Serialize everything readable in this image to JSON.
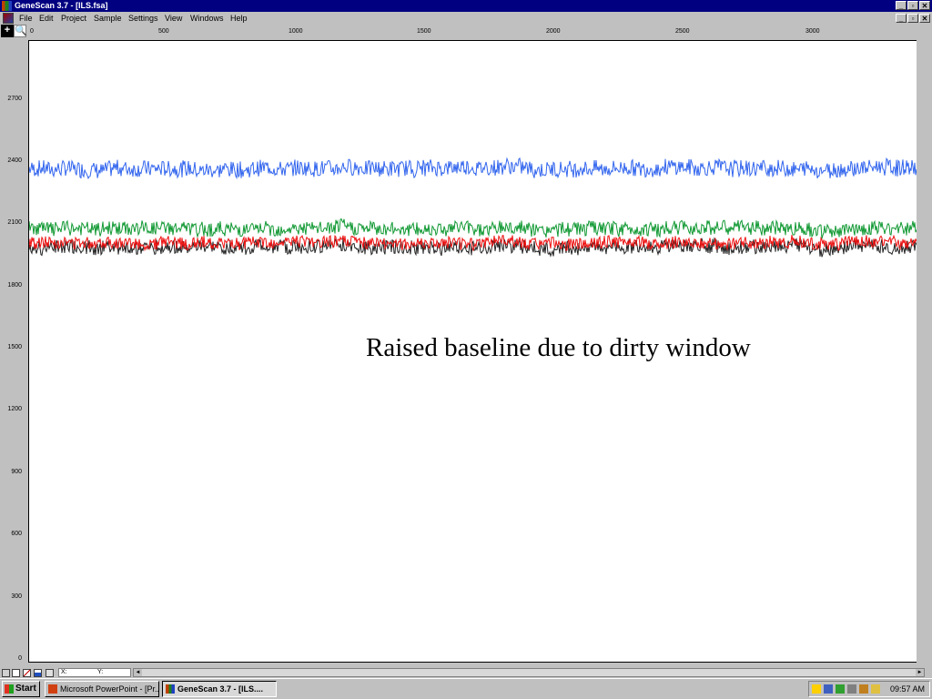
{
  "window": {
    "title": "GeneScan 3.7 - [ILS.fsa]",
    "controls": [
      "_",
      "▫",
      "✕"
    ]
  },
  "menu": [
    {
      "label": "File"
    },
    {
      "label": "Edit"
    },
    {
      "label": "Project"
    },
    {
      "label": "Sample"
    },
    {
      "label": "Settings"
    },
    {
      "label": "View"
    },
    {
      "label": "Windows"
    },
    {
      "label": "Help"
    }
  ],
  "toolbar": {
    "cross_tool": "+",
    "zoom_tool": "🔍"
  },
  "x_axis": {
    "ticks": [
      "0",
      "500",
      "1000",
      "1500",
      "2000",
      "2500",
      "3000"
    ]
  },
  "y_axis": {
    "ticks": [
      "2700",
      "2400",
      "2100",
      "1800",
      "1500",
      "1200",
      "900",
      "600",
      "300",
      "0"
    ]
  },
  "chart_data": {
    "type": "line",
    "x_range": [
      0,
      3400
    ],
    "ylim": [
      0,
      3000
    ],
    "series": [
      {
        "color": "#3366ee",
        "baseline": 2370,
        "noise": 40
      },
      {
        "color": "#119933",
        "baseline": 2080,
        "noise": 35
      },
      {
        "color": "#222222",
        "baseline": 1990,
        "noise": 35
      },
      {
        "color": "#ee1111",
        "baseline": 2010,
        "noise": 30
      }
    ]
  },
  "annotation": "Raised baseline due to dirty window",
  "statusbar": {
    "x_label": "X:",
    "y_label": "Y:"
  },
  "taskbar": {
    "start": "Start",
    "tasks": [
      {
        "label": "Microsoft PowerPoint - [Pr..."
      },
      {
        "label": "GeneScan 3.7 - [ILS...."
      }
    ],
    "clock": "09:57 AM"
  }
}
